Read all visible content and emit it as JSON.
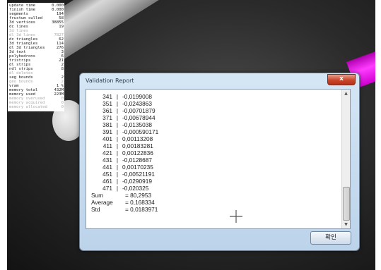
{
  "stats_panel": {
    "rows": [
      {
        "label": "update time",
        "value": "0.000",
        "dim": false
      },
      {
        "label": "finish time",
        "value": "0.000",
        "dim": false
      },
      {
        "label": "segments",
        "value": "194",
        "dim": false
      },
      {
        "label": "frustum culled",
        "value": "58",
        "dim": false
      },
      {
        "label": "3d vertices",
        "value": "38855",
        "dim": false
      },
      {
        "label": "dc lines",
        "value": "19",
        "dim": false
      },
      {
        "label": "3d lines",
        "value": "",
        "dim": true
      },
      {
        "label": "dl 3d lines",
        "value": "7827",
        "dim": true
      },
      {
        "label": "dc triangles",
        "value": "62",
        "dim": false
      },
      {
        "label": "3d triangles",
        "value": "114",
        "dim": false
      },
      {
        "label": "dl 3d triangles",
        "value": "276",
        "dim": false
      },
      {
        "label": "3d text",
        "value": "3",
        "dim": false
      },
      {
        "label": "polyhedrons",
        "value": "6",
        "dim": false
      },
      {
        "label": "tristrips",
        "value": "21",
        "dim": false
      },
      {
        "label": "dl strips",
        "value": "2",
        "dim": false
      },
      {
        "label": "ndl strips",
        "value": "8",
        "dim": false
      },
      {
        "label": "dl deletes",
        "value": "",
        "dim": true
      },
      {
        "label": "seg bounds",
        "value": "2",
        "dim": false
      },
      {
        "label": "geo bounds",
        "value": "2",
        "dim": true
      },
      {
        "label": "vram",
        "value": "1 %",
        "dim": false
      },
      {
        "label": "memory total",
        "value": "432M",
        "dim": false
      },
      {
        "label": "memory used",
        "value": "223M",
        "dim": false
      },
      {
        "label": "memory overused",
        "value": "0",
        "dim": true
      },
      {
        "label": "memory acquired",
        "value": "0",
        "dim": true
      },
      {
        "label": "memory allocated",
        "value": "0",
        "dim": true
      }
    ]
  },
  "dialog": {
    "title": "Validation Report",
    "close_label": "x",
    "ok_label": "확인",
    "summary": [
      {
        "label": "Sum",
        "value": "= 80,2953"
      },
      {
        "label": "Average",
        "value": "= 0,168334"
      },
      {
        "label": "Std",
        "value": "= 0,0183971"
      }
    ]
  },
  "chart_data": {
    "type": "table",
    "columns": [
      "index",
      "value"
    ],
    "rows": [
      {
        "index": "341",
        "value": "-0,0199008"
      },
      {
        "index": "351",
        "value": "-0,0243863"
      },
      {
        "index": "361",
        "value": "-0,00701879"
      },
      {
        "index": "371",
        "value": "-0,00678944"
      },
      {
        "index": "381",
        "value": "-0,0135038"
      },
      {
        "index": "391",
        "value": "-0,000590171"
      },
      {
        "index": "401",
        "value": "0,00113208"
      },
      {
        "index": "411",
        "value": "0,00183281"
      },
      {
        "index": "421",
        "value": "0,00122836"
      },
      {
        "index": "431",
        "value": "-0,0128687"
      },
      {
        "index": "441",
        "value": "0,00170235"
      },
      {
        "index": "451",
        "value": "-0,00521191"
      },
      {
        "index": "461",
        "value": "-0,0290919"
      },
      {
        "index": "471",
        "value": "-0,020325"
      }
    ]
  }
}
